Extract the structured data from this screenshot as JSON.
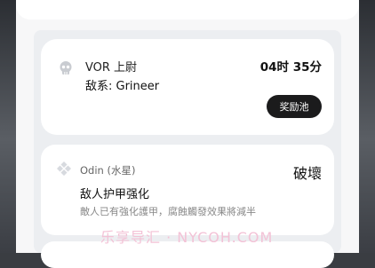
{
  "alert_card": {
    "title": "VOR 上尉",
    "enemy": "敌系: Grineer",
    "timer": "04时 35分",
    "reward_button": "奖励池"
  },
  "modifier_card": {
    "planet": "Odin (水星)",
    "status": "破壞",
    "modifier_title": "敌人护甲强化",
    "modifier_desc": "敵人已有強化護甲，腐蝕觸發效果將減半"
  },
  "watermark": "乐享导汇 · NYCOH.COM",
  "colors": {
    "button_bg": "#1b1b1c",
    "panel_bg": "#eceef1",
    "card_bg": "#ffffff",
    "muted_text": "#888888"
  },
  "icons": {
    "alert_icon": "skull-icon",
    "planet_icon": "diamond-node-icon"
  }
}
